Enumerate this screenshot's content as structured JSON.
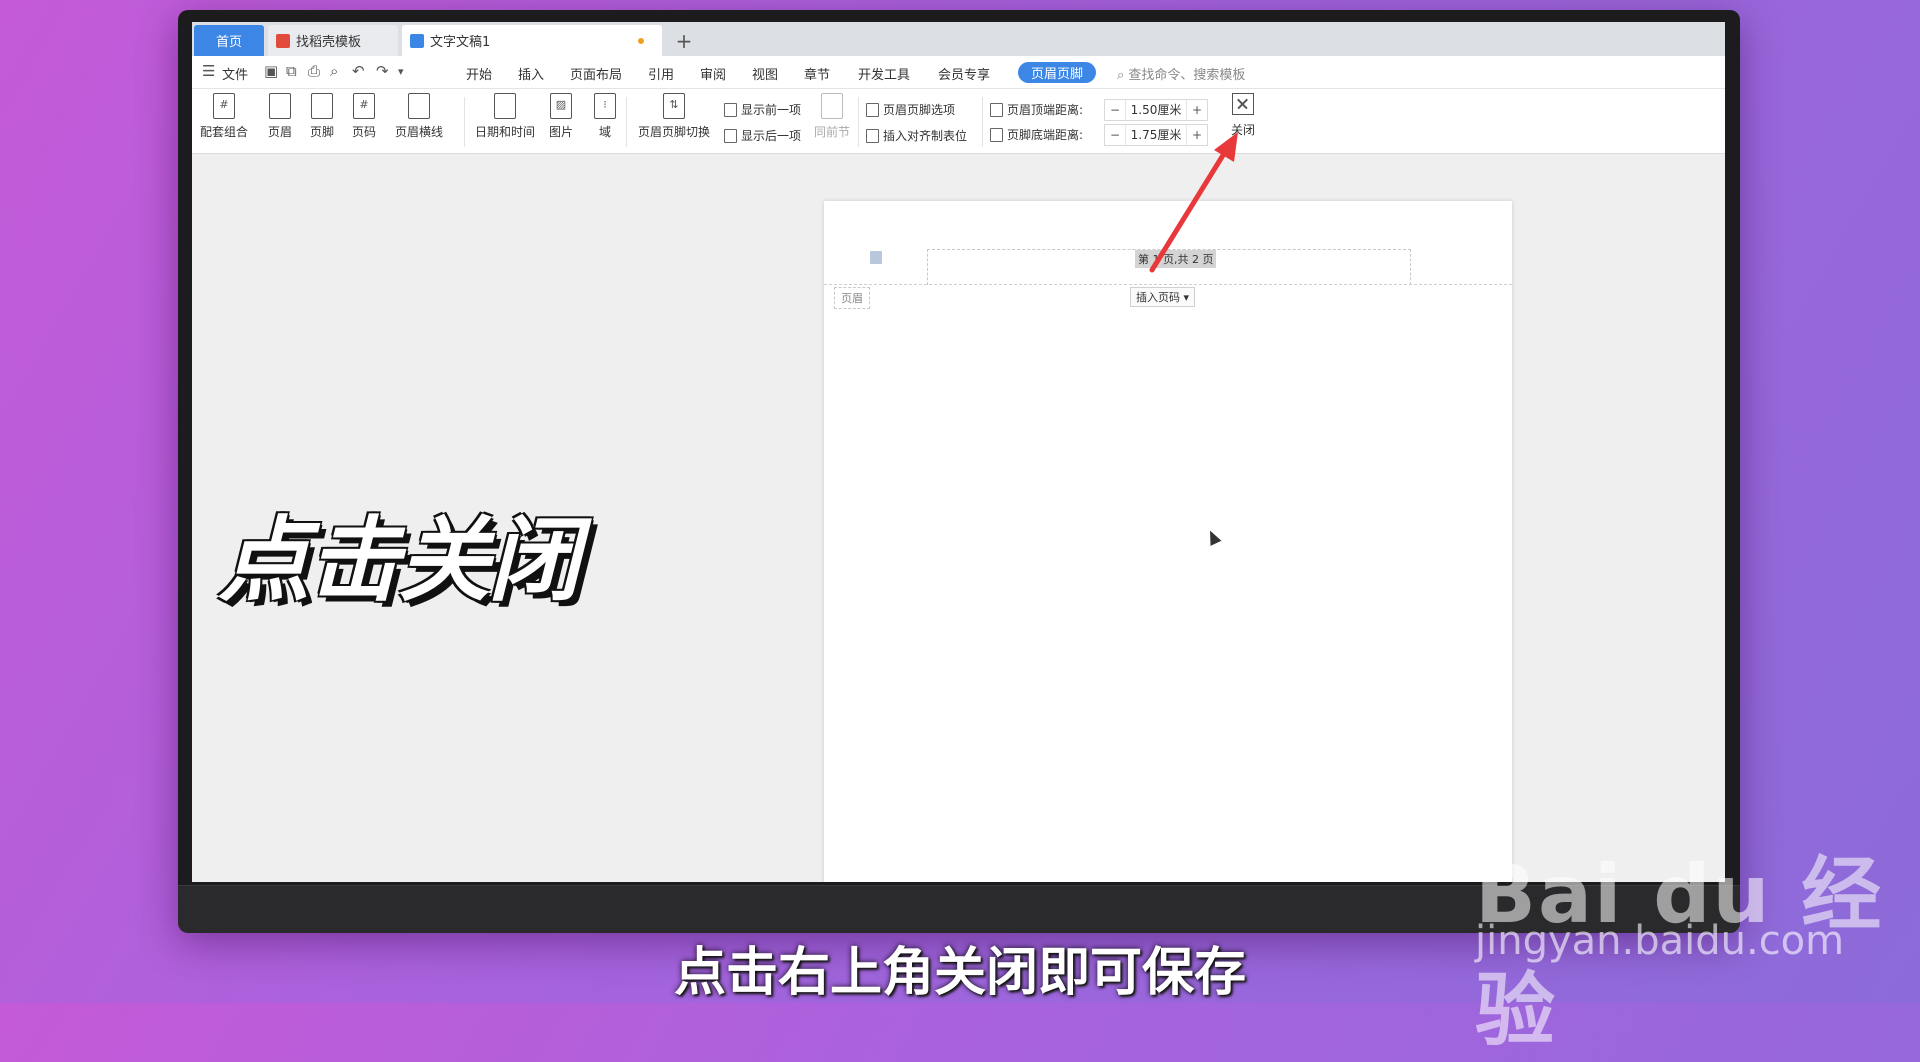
{
  "tabs": {
    "home": "首页",
    "template": "找稻壳模板",
    "document": "文字文稿1",
    "add": "+"
  },
  "menu": {
    "file": "文件",
    "items": [
      "开始",
      "插入",
      "页面布局",
      "引用",
      "审阅",
      "视图",
      "章节",
      "开发工具",
      "会员专享"
    ],
    "active": "页眉页脚",
    "search_placeholder": "查找命令、搜索模板"
  },
  "ribbon": {
    "combo": "配套组合",
    "header": "页眉",
    "footer": "页脚",
    "pagenum": "页码",
    "header_line": "页眉横线",
    "datetime": "日期和时间",
    "picture": "图片",
    "field": "域",
    "switch": "页眉页脚切换",
    "show_prev": "显示前一项",
    "show_next": "显示后一项",
    "same_prev": "同前节",
    "options": "页眉页脚选项",
    "insert_tab": "插入对齐制表位",
    "top_dist_label": "页眉顶端距离:",
    "top_dist_value": "1.50厘米",
    "bottom_dist_label": "页脚底端距离:",
    "bottom_dist_value": "1.75厘米",
    "minus": "−",
    "plus": "+",
    "close": "关闭"
  },
  "page": {
    "page_number_text": "第 1 页,共 2 页",
    "header_tag": "页眉",
    "insert_page_number": "插入页码"
  },
  "overlay": {
    "title": "点击关闭",
    "subtitle": "点击右上角关闭即可保存",
    "watermark_brand": "Bai du 经验",
    "watermark_url": "jingyan.baidu.com"
  },
  "colors": {
    "accent": "#3c86e6",
    "arrow": "#e8383a"
  }
}
